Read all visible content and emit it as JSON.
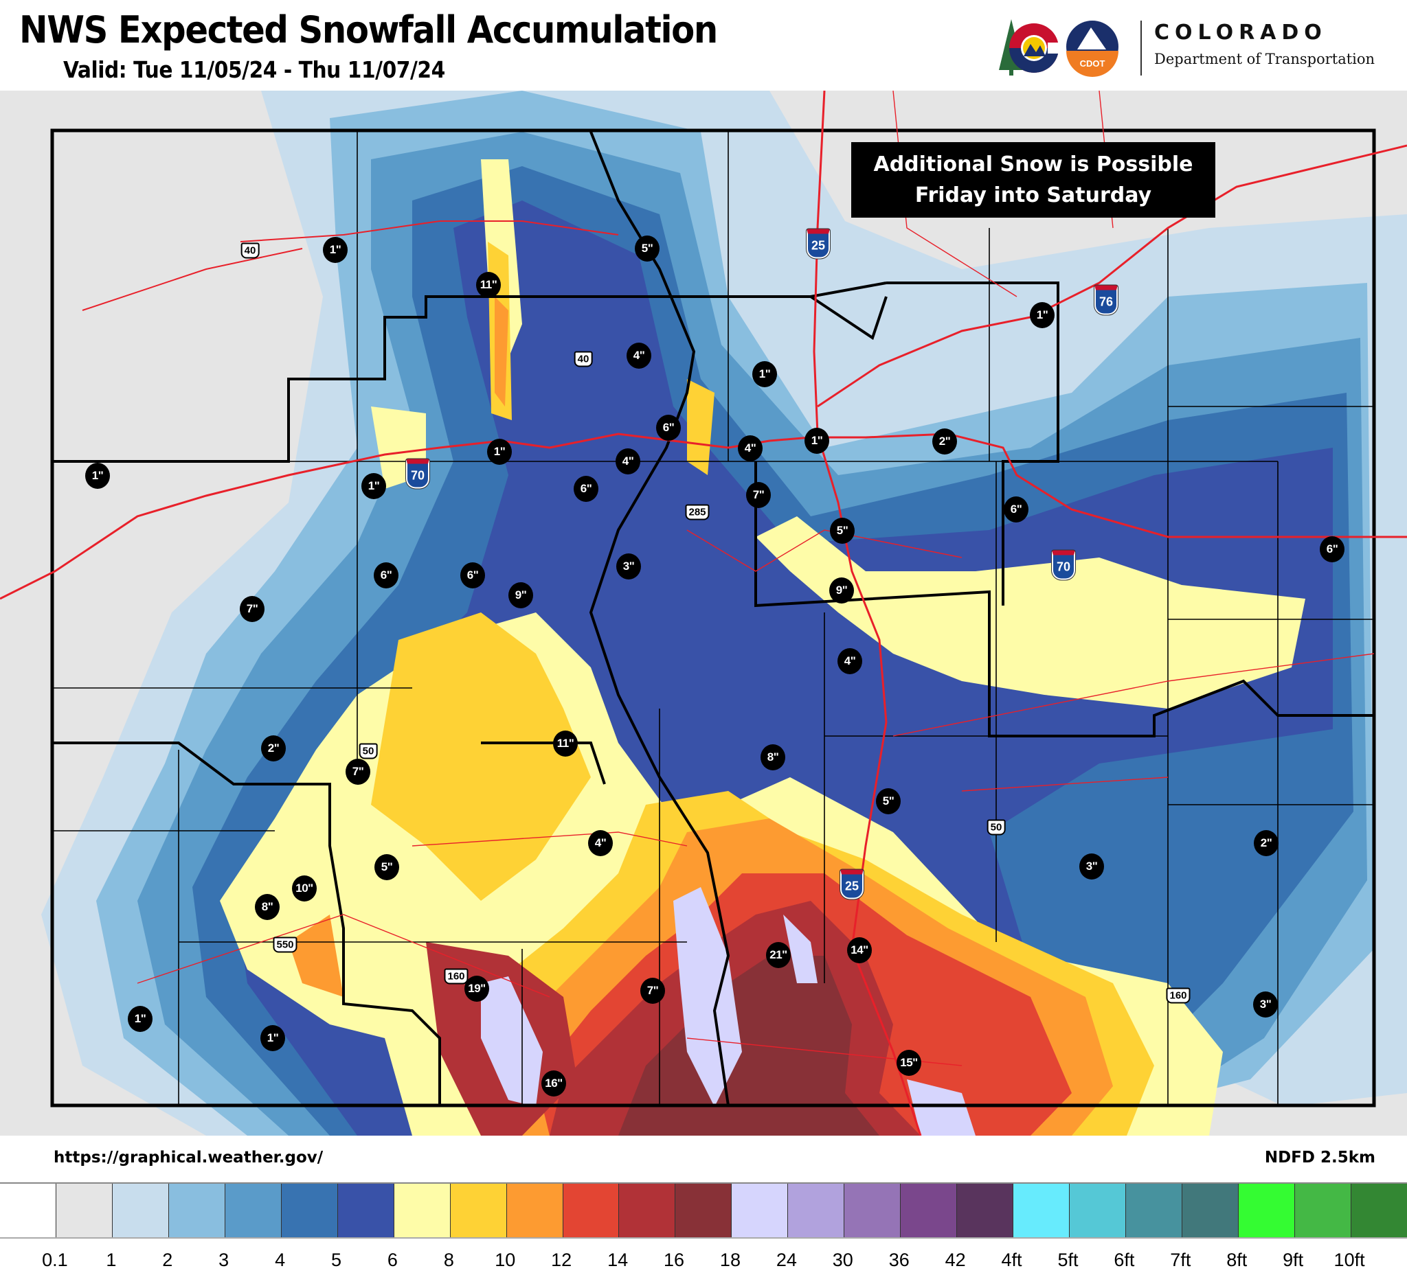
{
  "header": {
    "title": "NWS Expected Snowfall Accumulation",
    "valid": "Valid: Tue 11/05/24 - Thu 11/07/24"
  },
  "logo": {
    "state_logo_icon": "colorado-c-logo-icon",
    "cdot_badge_icon": "cdot-badge-icon",
    "cdot_badge_text": "CDOT",
    "colorado": "COLORADO",
    "department": "Department of Transportation"
  },
  "callout": {
    "line1": "Additional Snow is Possible",
    "line2": "Friday into Saturday"
  },
  "footer": {
    "source_url": "https://graphical.weather.gov/",
    "resolution": "NDFD 2.5km"
  },
  "colors": {
    "state_border": "#000000",
    "roads": "#e8202a",
    "marker_bg": "#000000",
    "marker_text": "#ffffff"
  },
  "legend": [
    {
      "label": "0.1",
      "color": "#ffffff"
    },
    {
      "label": "1",
      "color": "#e5e5e5"
    },
    {
      "label": "2",
      "color": "#c8dded"
    },
    {
      "label": "3",
      "color": "#89bedf"
    },
    {
      "label": "4",
      "color": "#5a9bc9"
    },
    {
      "label": "5",
      "color": "#3873b1"
    },
    {
      "label": "6",
      "color": "#3952a8"
    },
    {
      "label": "8",
      "color": "#fefca8"
    },
    {
      "label": "10",
      "color": "#fed235"
    },
    {
      "label": "12",
      "color": "#fd9b31"
    },
    {
      "label": "14",
      "color": "#e34533"
    },
    {
      "label": "16",
      "color": "#b13237"
    },
    {
      "label": "18",
      "color": "#883137"
    },
    {
      "label": "24",
      "color": "#d6d5fd"
    },
    {
      "label": "30",
      "color": "#b1a2dd"
    },
    {
      "label": "36",
      "color": "#9574b6"
    },
    {
      "label": "42",
      "color": "#7a478c"
    },
    {
      "label": "4ft",
      "color": "#59345d"
    },
    {
      "label": "5ft",
      "color": "#67ebfd"
    },
    {
      "label": "6ft",
      "color": "#55c8d6"
    },
    {
      "label": "7ft",
      "color": "#47929e"
    },
    {
      "label": "8ft",
      "color": "#41787b"
    },
    {
      "label": "9ft",
      "color": "#34fc32"
    },
    {
      "label": "10ft",
      "color": "#44b845"
    },
    {
      "label": "",
      "color": "#338733"
    }
  ],
  "snowfall_markers": [
    {
      "label": "1\"",
      "value_in": 1,
      "location": "northwest"
    },
    {
      "label": "11\"",
      "value_in": 11,
      "location": "park-range"
    },
    {
      "label": "5\"",
      "value_in": 5,
      "location": "north-front-range"
    },
    {
      "label": "4\"",
      "value_in": 4,
      "location": "rabbit-ears"
    },
    {
      "label": "1\"",
      "value_in": 1,
      "location": "fort-collins"
    },
    {
      "label": "1\"",
      "value_in": 1,
      "location": "northeast"
    },
    {
      "label": "6\"",
      "value_in": 6,
      "location": "boulder-foothills"
    },
    {
      "label": "1\"",
      "value_in": 1,
      "location": "grand-junction-north"
    },
    {
      "label": "1\"",
      "value_in": 1,
      "location": "i70-west"
    },
    {
      "label": "1\"",
      "value_in": 1,
      "location": "glenwood"
    },
    {
      "label": "4\"",
      "value_in": 4,
      "location": "summit"
    },
    {
      "label": "4\"",
      "value_in": 4,
      "location": "evergreen"
    },
    {
      "label": "1\"",
      "value_in": 1,
      "location": "denver"
    },
    {
      "label": "2\"",
      "value_in": 2,
      "location": "east-denver"
    },
    {
      "label": "6\"",
      "value_in": 6,
      "location": "vail"
    },
    {
      "label": "7\"",
      "value_in": 7,
      "location": "castle-rock-west"
    },
    {
      "label": "6\"",
      "value_in": 6,
      "location": "limon-north"
    },
    {
      "label": "5\"",
      "value_in": 5,
      "location": "monument"
    },
    {
      "label": "3\"",
      "value_in": 3,
      "location": "south-park"
    },
    {
      "label": "6\"",
      "value_in": 6,
      "location": "aspen-north"
    },
    {
      "label": "6\"",
      "value_in": 6,
      "location": "aspen"
    },
    {
      "label": "9\"",
      "value_in": 9,
      "location": "independence-pass"
    },
    {
      "label": "9\"",
      "value_in": 9,
      "location": "colorado-springs"
    },
    {
      "label": "6\"",
      "value_in": 6,
      "location": "kansas-border-i70"
    },
    {
      "label": "7\"",
      "value_in": 7,
      "location": "grand-mesa"
    },
    {
      "label": "4\"",
      "value_in": 4,
      "location": "fountain"
    },
    {
      "label": "2\"",
      "value_in": 2,
      "location": "delta"
    },
    {
      "label": "7\"",
      "value_in": 7,
      "location": "montrose"
    },
    {
      "label": "11\"",
      "value_in": 11,
      "location": "monarch"
    },
    {
      "label": "8\"",
      "value_in": 8,
      "location": "canon-city"
    },
    {
      "label": "5\"",
      "value_in": 5,
      "location": "pueblo-north"
    },
    {
      "label": "4\"",
      "value_in": 4,
      "location": "saguache"
    },
    {
      "label": "5\"",
      "value_in": 5,
      "location": "lake-city"
    },
    {
      "label": "3\"",
      "value_in": 3,
      "location": "la-junta"
    },
    {
      "label": "2\"",
      "value_in": 2,
      "location": "lamar-north"
    },
    {
      "label": "10\"",
      "value_in": 10,
      "location": "ouray"
    },
    {
      "label": "8\"",
      "value_in": 8,
      "location": "silverton"
    },
    {
      "label": "21\"",
      "value_in": 21,
      "location": "sangre-de-cristo"
    },
    {
      "label": "14\"",
      "value_in": 14,
      "location": "walsenburg"
    },
    {
      "label": "19\"",
      "value_in": 19,
      "location": "wolf-creek"
    },
    {
      "label": "7\"",
      "value_in": 7,
      "location": "san-luis-valley"
    },
    {
      "label": "3\"",
      "value_in": 3,
      "location": "springfield"
    },
    {
      "label": "1\"",
      "value_in": 1,
      "location": "cortez"
    },
    {
      "label": "1\"",
      "value_in": 1,
      "location": "durango"
    },
    {
      "label": "15\"",
      "value_in": 15,
      "location": "trinidad"
    },
    {
      "label": "16\"",
      "value_in": 16,
      "location": "pagosa-south"
    }
  ],
  "route_shields": [
    {
      "type": "us",
      "number": "40",
      "location": "craig"
    },
    {
      "type": "us",
      "number": "40",
      "location": "kremmling"
    },
    {
      "type": "interstate",
      "number": "25",
      "location": "north"
    },
    {
      "type": "interstate",
      "number": "76",
      "location": "northeast"
    },
    {
      "type": "interstate",
      "number": "70",
      "location": "west"
    },
    {
      "type": "us",
      "number": "285",
      "location": "south-park"
    },
    {
      "type": "interstate",
      "number": "70",
      "location": "east"
    },
    {
      "type": "us",
      "number": "50",
      "location": "montrose"
    },
    {
      "type": "us",
      "number": "50",
      "location": "east"
    },
    {
      "type": "interstate",
      "number": "25",
      "location": "south"
    },
    {
      "type": "us",
      "number": "550",
      "location": "southwest"
    },
    {
      "type": "us",
      "number": "160",
      "location": "wolf-creek"
    },
    {
      "type": "us",
      "number": "160",
      "location": "southeast"
    }
  ]
}
